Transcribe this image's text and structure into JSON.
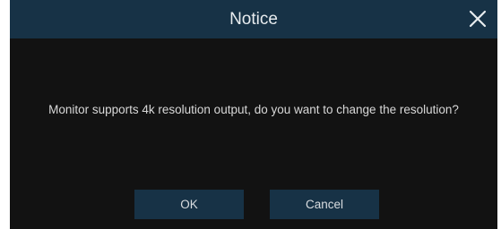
{
  "dialog": {
    "title": "Notice",
    "message": "Monitor supports 4k resolution output, do you want to change the resolution?",
    "close_icon": "close-icon",
    "ok_label": "OK",
    "cancel_label": "Cancel"
  },
  "colors": {
    "titlebar": "#173246",
    "body": "#121212",
    "button": "#173246",
    "text": "#d8d8d8"
  }
}
